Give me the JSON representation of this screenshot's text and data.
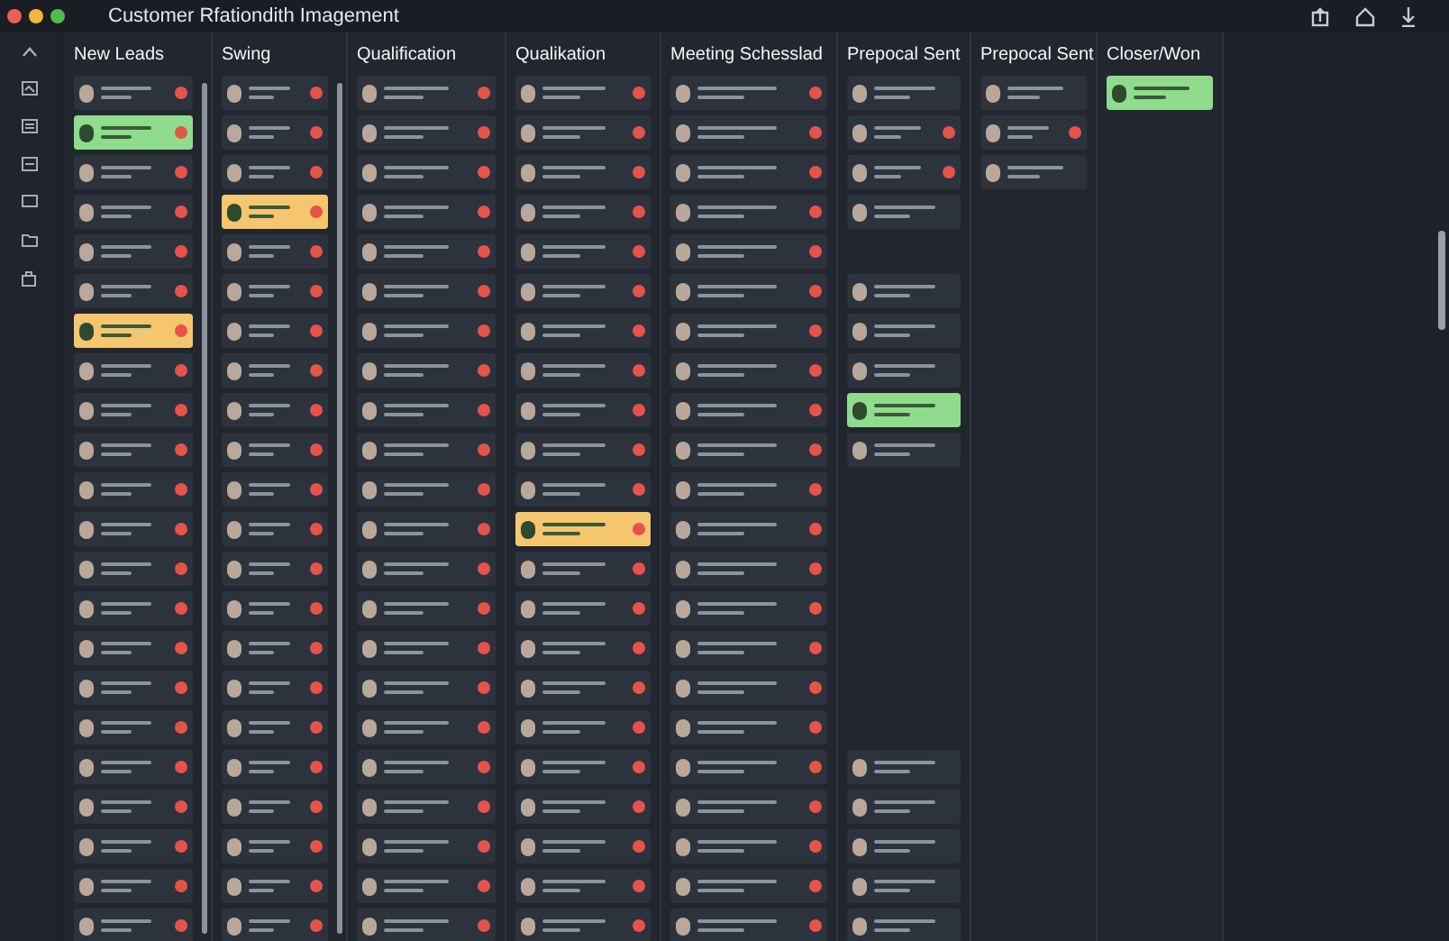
{
  "window": {
    "title": "Customer Rfationdith Imagement"
  },
  "columns": [
    {
      "title": "New Leads",
      "scrollbar": true,
      "cards": [
        {
          "kind": "card",
          "color": "#2d333d",
          "alert": true
        },
        {
          "kind": "card",
          "color": "#8fdc8c",
          "alert": true
        },
        {
          "kind": "card",
          "color": "#2d333d",
          "alert": true
        },
        {
          "kind": "card",
          "color": "#2d333d",
          "alert": true
        },
        {
          "kind": "card",
          "color": "#2d333d",
          "alert": true
        },
        {
          "kind": "card",
          "color": "#2d333d",
          "alert": true
        },
        {
          "kind": "card",
          "color": "#f5c66e",
          "alert": true
        },
        {
          "kind": "card",
          "color": "#2d333d",
          "alert": true
        },
        {
          "kind": "card",
          "color": "#2d333d",
          "alert": true
        },
        {
          "kind": "card",
          "color": "#2d333d",
          "alert": true
        },
        {
          "kind": "card",
          "color": "#2d333d",
          "alert": true
        },
        {
          "kind": "card",
          "color": "#2d333d",
          "alert": true
        },
        {
          "kind": "card",
          "color": "#2d333d",
          "alert": true
        },
        {
          "kind": "card",
          "color": "#2d333d",
          "alert": true
        },
        {
          "kind": "card",
          "color": "#2d333d",
          "alert": true
        },
        {
          "kind": "card",
          "color": "#2d333d",
          "alert": true
        },
        {
          "kind": "card",
          "color": "#2d333d",
          "alert": true
        },
        {
          "kind": "card",
          "color": "#2d333d",
          "alert": true
        },
        {
          "kind": "card",
          "color": "#2d333d",
          "alert": true
        },
        {
          "kind": "card",
          "color": "#2d333d",
          "alert": true
        },
        {
          "kind": "card",
          "color": "#2d333d",
          "alert": true
        },
        {
          "kind": "card",
          "color": "#2d333d",
          "alert": true
        }
      ]
    },
    {
      "title": "Swing",
      "scrollbar": true,
      "cards": [
        {
          "kind": "card",
          "color": "#2d333d",
          "alert": true
        },
        {
          "kind": "card",
          "color": "#2d333d",
          "alert": true
        },
        {
          "kind": "card",
          "color": "#2d333d",
          "alert": true
        },
        {
          "kind": "card",
          "color": "#f5c66e",
          "alert": true
        },
        {
          "kind": "card",
          "color": "#2d333d",
          "alert": true
        },
        {
          "kind": "card",
          "color": "#2d333d",
          "alert": true
        },
        {
          "kind": "card",
          "color": "#2d333d",
          "alert": true
        },
        {
          "kind": "card",
          "color": "#2d333d",
          "alert": true
        },
        {
          "kind": "card",
          "color": "#2d333d",
          "alert": true
        },
        {
          "kind": "card",
          "color": "#2d333d",
          "alert": true
        },
        {
          "kind": "card",
          "color": "#2d333d",
          "alert": true
        },
        {
          "kind": "card",
          "color": "#2d333d",
          "alert": true
        },
        {
          "kind": "card",
          "color": "#2d333d",
          "alert": true
        },
        {
          "kind": "card",
          "color": "#2d333d",
          "alert": true
        },
        {
          "kind": "card",
          "color": "#2d333d",
          "alert": true
        },
        {
          "kind": "card",
          "color": "#2d333d",
          "alert": true
        },
        {
          "kind": "card",
          "color": "#2d333d",
          "alert": true
        },
        {
          "kind": "card",
          "color": "#2d333d",
          "alert": true
        },
        {
          "kind": "card",
          "color": "#2d333d",
          "alert": true
        },
        {
          "kind": "card",
          "color": "#2d333d",
          "alert": true
        },
        {
          "kind": "card",
          "color": "#2d333d",
          "alert": true
        },
        {
          "kind": "card",
          "color": "#2d333d",
          "alert": true
        }
      ]
    },
    {
      "title": "Qualification",
      "scrollbar": false,
      "cards": [
        {
          "kind": "card",
          "color": "#2d333d",
          "alert": true
        },
        {
          "kind": "card",
          "color": "#2d333d",
          "alert": true
        },
        {
          "kind": "card",
          "color": "#2d333d",
          "alert": true
        },
        {
          "kind": "card",
          "color": "#2d333d",
          "alert": true
        },
        {
          "kind": "card",
          "color": "#2d333d",
          "alert": true
        },
        {
          "kind": "card",
          "color": "#2d333d",
          "alert": true
        },
        {
          "kind": "card",
          "color": "#2d333d",
          "alert": true
        },
        {
          "kind": "card",
          "color": "#2d333d",
          "alert": true
        },
        {
          "kind": "card",
          "color": "#2d333d",
          "alert": true
        },
        {
          "kind": "card",
          "color": "#2d333d",
          "alert": true
        },
        {
          "kind": "card",
          "color": "#2d333d",
          "alert": true
        },
        {
          "kind": "card",
          "color": "#2d333d",
          "alert": true
        },
        {
          "kind": "card",
          "color": "#2d333d",
          "alert": true
        },
        {
          "kind": "card",
          "color": "#2d333d",
          "alert": true
        },
        {
          "kind": "card",
          "color": "#2d333d",
          "alert": true
        },
        {
          "kind": "card",
          "color": "#2d333d",
          "alert": true
        },
        {
          "kind": "card",
          "color": "#2d333d",
          "alert": true
        },
        {
          "kind": "card",
          "color": "#2d333d",
          "alert": true
        },
        {
          "kind": "card",
          "color": "#2d333d",
          "alert": true
        },
        {
          "kind": "card",
          "color": "#2d333d",
          "alert": true
        },
        {
          "kind": "card",
          "color": "#2d333d",
          "alert": true
        },
        {
          "kind": "card",
          "color": "#2d333d",
          "alert": true
        }
      ]
    },
    {
      "title": "Qualikation",
      "scrollbar": false,
      "cards": [
        {
          "kind": "card",
          "color": "#2d333d",
          "alert": true
        },
        {
          "kind": "card",
          "color": "#2d333d",
          "alert": true
        },
        {
          "kind": "card",
          "color": "#2d333d",
          "alert": true
        },
        {
          "kind": "card",
          "color": "#2d333d",
          "alert": true
        },
        {
          "kind": "card",
          "color": "#2d333d",
          "alert": true
        },
        {
          "kind": "card",
          "color": "#2d333d",
          "alert": true
        },
        {
          "kind": "card",
          "color": "#2d333d",
          "alert": true
        },
        {
          "kind": "card",
          "color": "#2d333d",
          "alert": true
        },
        {
          "kind": "card",
          "color": "#2d333d",
          "alert": true
        },
        {
          "kind": "card",
          "color": "#2d333d",
          "alert": true
        },
        {
          "kind": "card",
          "color": "#2d333d",
          "alert": true
        },
        {
          "kind": "card",
          "color": "#f5c66e",
          "alert": true
        },
        {
          "kind": "card",
          "color": "#2d333d",
          "alert": true
        },
        {
          "kind": "card",
          "color": "#2d333d",
          "alert": true
        },
        {
          "kind": "card",
          "color": "#2d333d",
          "alert": true
        },
        {
          "kind": "card",
          "color": "#2d333d",
          "alert": true
        },
        {
          "kind": "card",
          "color": "#2d333d",
          "alert": true
        },
        {
          "kind": "card",
          "color": "#2d333d",
          "alert": true
        },
        {
          "kind": "card",
          "color": "#2d333d",
          "alert": true
        },
        {
          "kind": "card",
          "color": "#2d333d",
          "alert": true
        },
        {
          "kind": "card",
          "color": "#2d333d",
          "alert": true
        },
        {
          "kind": "card",
          "color": "#2d333d",
          "alert": true
        }
      ]
    },
    {
      "title": "Meeting Schesslad",
      "scrollbar": false,
      "cards": [
        {
          "kind": "card",
          "color": "#2d333d",
          "alert": true
        },
        {
          "kind": "card",
          "color": "#2d333d",
          "alert": true
        },
        {
          "kind": "card",
          "color": "#2d333d",
          "alert": true
        },
        {
          "kind": "card",
          "color": "#2d333d",
          "alert": true
        },
        {
          "kind": "card",
          "color": "#2d333d",
          "alert": true
        },
        {
          "kind": "card",
          "color": "#2d333d",
          "alert": true
        },
        {
          "kind": "card",
          "color": "#2d333d",
          "alert": true
        },
        {
          "kind": "card",
          "color": "#2d333d",
          "alert": true
        },
        {
          "kind": "card",
          "color": "#2d333d",
          "alert": true
        },
        {
          "kind": "card",
          "color": "#2d333d",
          "alert": true
        },
        {
          "kind": "card",
          "color": "#2d333d",
          "alert": true
        },
        {
          "kind": "card",
          "color": "#2d333d",
          "alert": true
        },
        {
          "kind": "card",
          "color": "#2d333d",
          "alert": true
        },
        {
          "kind": "card",
          "color": "#2d333d",
          "alert": true
        },
        {
          "kind": "card",
          "color": "#2d333d",
          "alert": true
        },
        {
          "kind": "card",
          "color": "#2d333d",
          "alert": true
        },
        {
          "kind": "card",
          "color": "#2d333d",
          "alert": true
        },
        {
          "kind": "card",
          "color": "#2d333d",
          "alert": true
        },
        {
          "kind": "card",
          "color": "#2d333d",
          "alert": true
        },
        {
          "kind": "card",
          "color": "#2d333d",
          "alert": true
        },
        {
          "kind": "card",
          "color": "#2d333d",
          "alert": true
        },
        {
          "kind": "card",
          "color": "#2d333d",
          "alert": true
        }
      ]
    },
    {
      "title": "Prepocal Sent",
      "scrollbar": false,
      "cards": [
        {
          "kind": "card",
          "color": "#2d333d",
          "alert": false
        },
        {
          "kind": "card",
          "color": "#2d333d",
          "alert": true
        },
        {
          "kind": "card",
          "color": "#2d333d",
          "alert": true
        },
        {
          "kind": "card",
          "color": "#2d333d",
          "alert": false
        },
        {
          "kind": "gap"
        },
        {
          "kind": "card",
          "color": "#2d333d",
          "alert": false
        },
        {
          "kind": "card",
          "color": "#2d333d",
          "alert": false
        },
        {
          "kind": "card",
          "color": "#2d333d",
          "alert": false
        },
        {
          "kind": "card",
          "color": "#8fdc8c",
          "alert": false
        },
        {
          "kind": "card",
          "color": "#2d333d",
          "alert": false
        },
        {
          "kind": "gap"
        },
        {
          "kind": "gap"
        },
        {
          "kind": "gap"
        },
        {
          "kind": "gap"
        },
        {
          "kind": "gap"
        },
        {
          "kind": "gap"
        },
        {
          "kind": "gap"
        },
        {
          "kind": "card",
          "color": "#2d333d",
          "alert": false
        },
        {
          "kind": "card",
          "color": "#2d333d",
          "alert": false
        },
        {
          "kind": "card",
          "color": "#2d333d",
          "alert": false
        },
        {
          "kind": "card",
          "color": "#2d333d",
          "alert": false
        },
        {
          "kind": "card",
          "color": "#2d333d",
          "alert": false
        }
      ]
    },
    {
      "title": "Prepocal Sent",
      "scrollbar": false,
      "cards": [
        {
          "kind": "card",
          "color": "#2d333d",
          "alert": false
        },
        {
          "kind": "card",
          "color": "#2d333d",
          "alert": true
        },
        {
          "kind": "card",
          "color": "#2d333d",
          "alert": false
        }
      ]
    },
    {
      "title": "Closer/Won",
      "scrollbar": false,
      "cards": [
        {
          "kind": "card",
          "color": "#8fdc8c",
          "alert": false
        }
      ]
    }
  ]
}
